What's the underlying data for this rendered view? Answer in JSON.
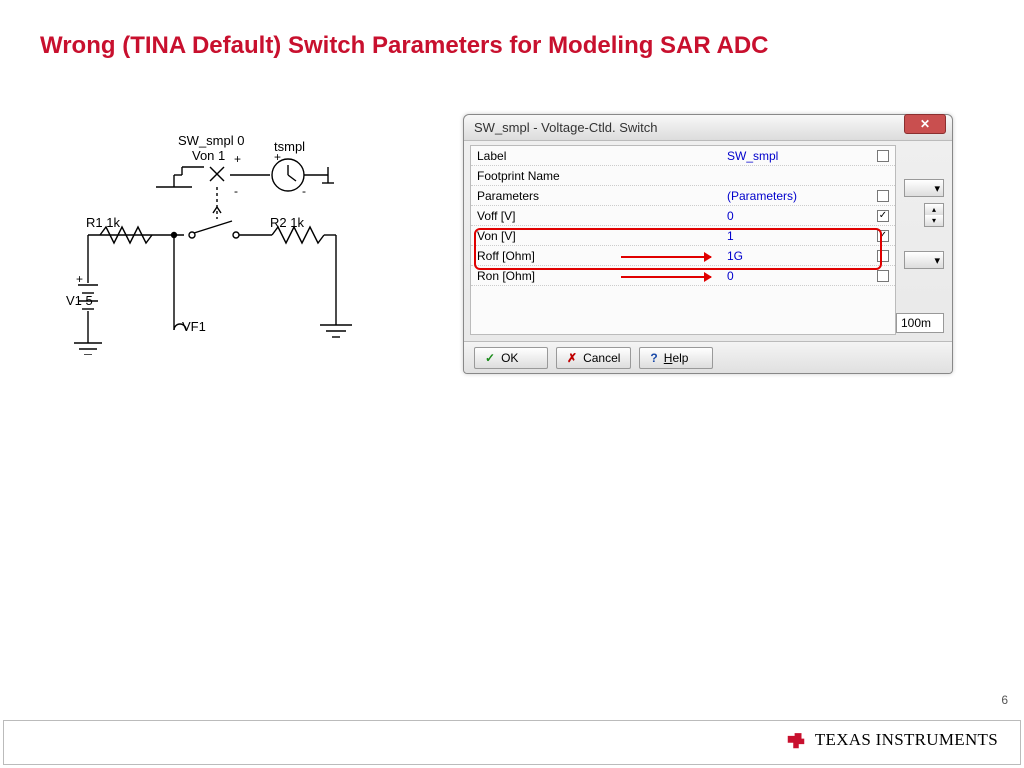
{
  "title": "Wrong (TINA Default) Switch Parameters for Modeling SAR ADC",
  "page_number": "6",
  "footer": {
    "brand": "TEXAS INSTRUMENTS"
  },
  "circuit": {
    "sw_label": "SW_smpl 0",
    "von_label": "Von 1",
    "tsmpl": "tsmpl",
    "r1": "R1 1k",
    "r2": "R2 1k",
    "v1": "V1 5",
    "vf1": "VF1"
  },
  "dialog": {
    "title": "SW_smpl - Voltage-Ctld. Switch",
    "rows": [
      {
        "name": "Label",
        "value": "SW_smpl",
        "checked": false
      },
      {
        "name": "Footprint Name",
        "value": "",
        "checked": null
      },
      {
        "name": "Parameters",
        "value": "(Parameters)",
        "checked": false
      },
      {
        "name": "Voff       [V]",
        "value": "0",
        "checked": true
      },
      {
        "name": "Von       [V]",
        "value": "1",
        "checked": true
      },
      {
        "name": "Roff      [Ohm]",
        "value": "1G",
        "checked": false
      },
      {
        "name": "Ron       [Ohm]",
        "value": "0",
        "checked": false
      }
    ],
    "readout": "100m",
    "ok": "OK",
    "cancel": "Cancel",
    "help": "Help"
  }
}
